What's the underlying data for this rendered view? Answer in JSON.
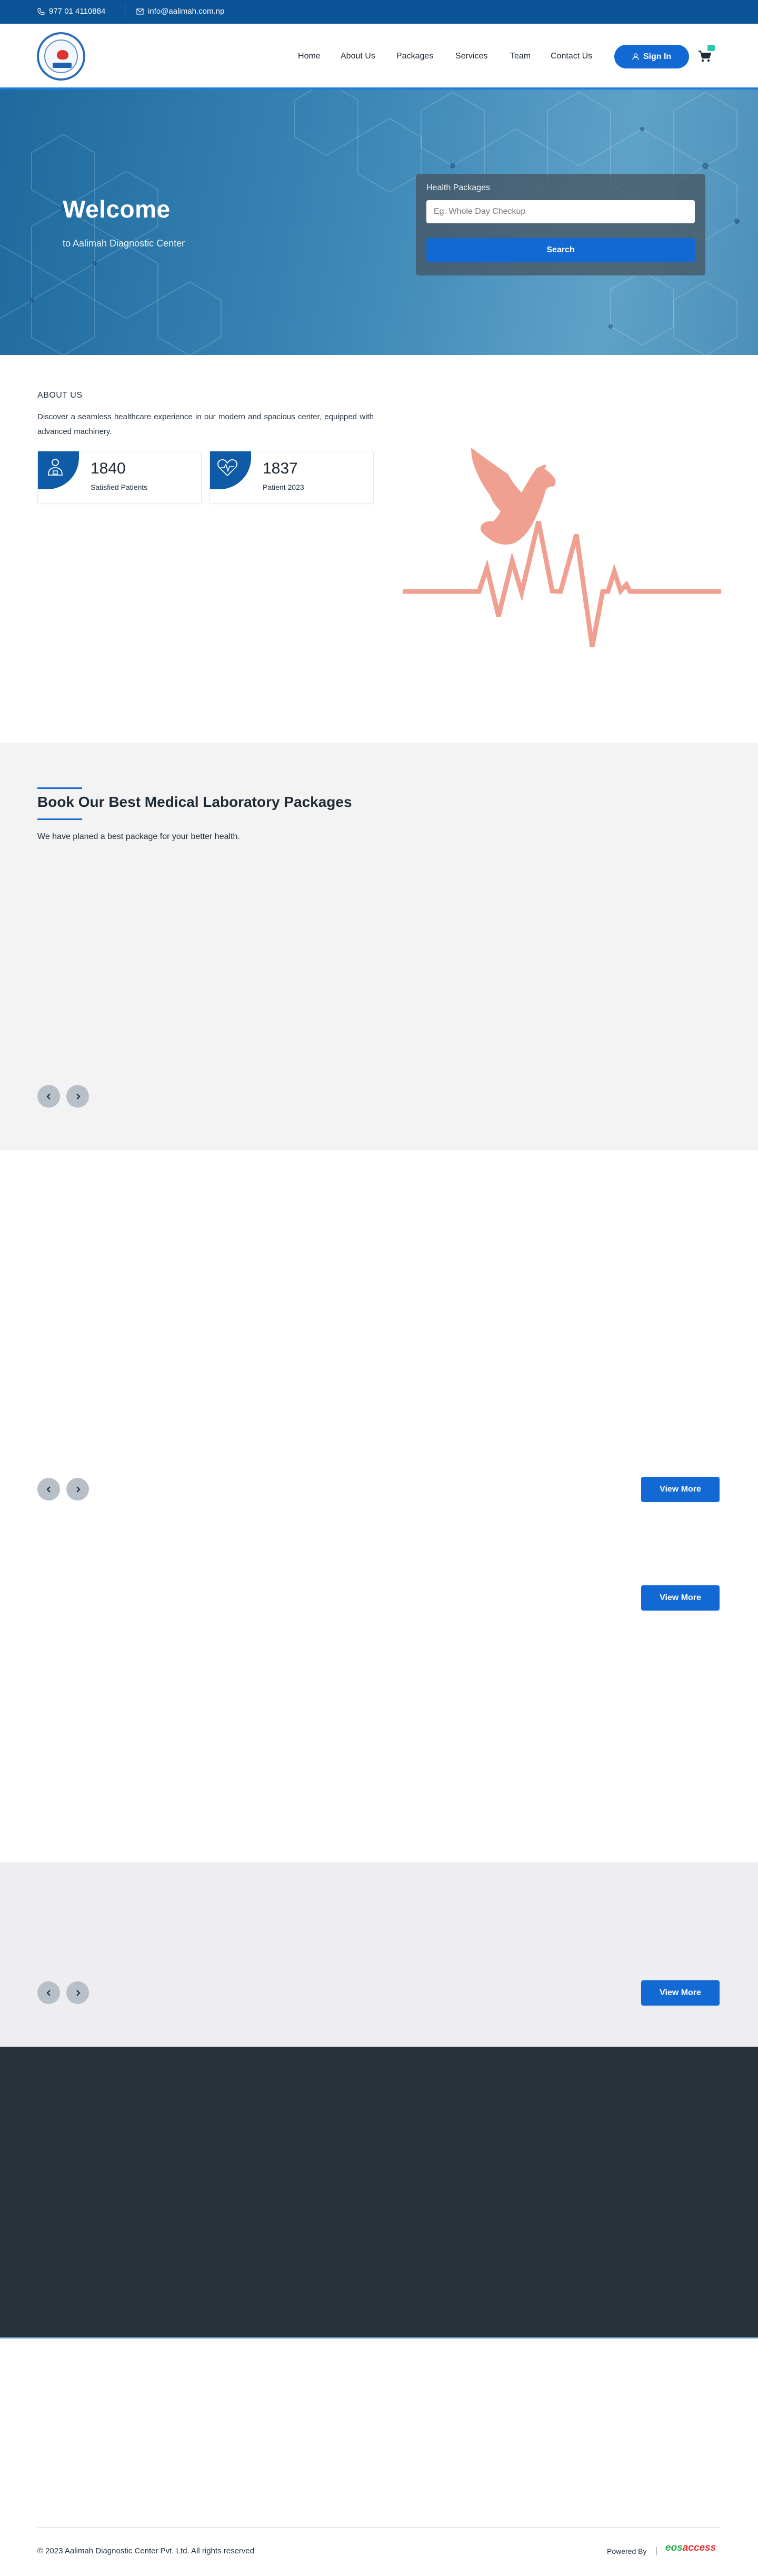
{
  "topbar": {
    "phone": "977 01 4110884",
    "email": "info@aalimah.com.np"
  },
  "nav": {
    "items": [
      "Home",
      "About Us",
      "Packages",
      "Services",
      "Team",
      "Contact Us"
    ],
    "signin_label": "Sign In"
  },
  "hero": {
    "title": "Welcome",
    "subtitle": "to Aalimah Diagnostic Center",
    "search_label": "Health Packages",
    "search_placeholder": "Eg. Whole Day Checkup",
    "search_button": "Search"
  },
  "about": {
    "title": "ABOUT US",
    "text": "Discover a seamless healthcare experience in our modern and spacious center, equipped with advanced machinery.",
    "stats": [
      {
        "number": "1840",
        "caption": "Satisfied Patients",
        "icon": "patient-icon"
      },
      {
        "number": "1837",
        "caption": "Patient 2023",
        "icon": "heart-icon"
      }
    ]
  },
  "packages": {
    "title": "Book Our Best Medical Laboratory Packages",
    "subtitle": "We have planed a best package for your better health."
  },
  "buttons": {
    "view_more": "View More"
  },
  "footer": {
    "copyright": "© 2023 Aalimah Diagnostic Center Pvt. Ltd. All rights reserved",
    "powered_by": "Powered By",
    "brand_eos": "eos",
    "brand_access": "access"
  },
  "colors": {
    "topbar": "#0b5397",
    "primary": "#1269d3",
    "footer_dark": "#283139",
    "illustration": "#f0a090"
  }
}
